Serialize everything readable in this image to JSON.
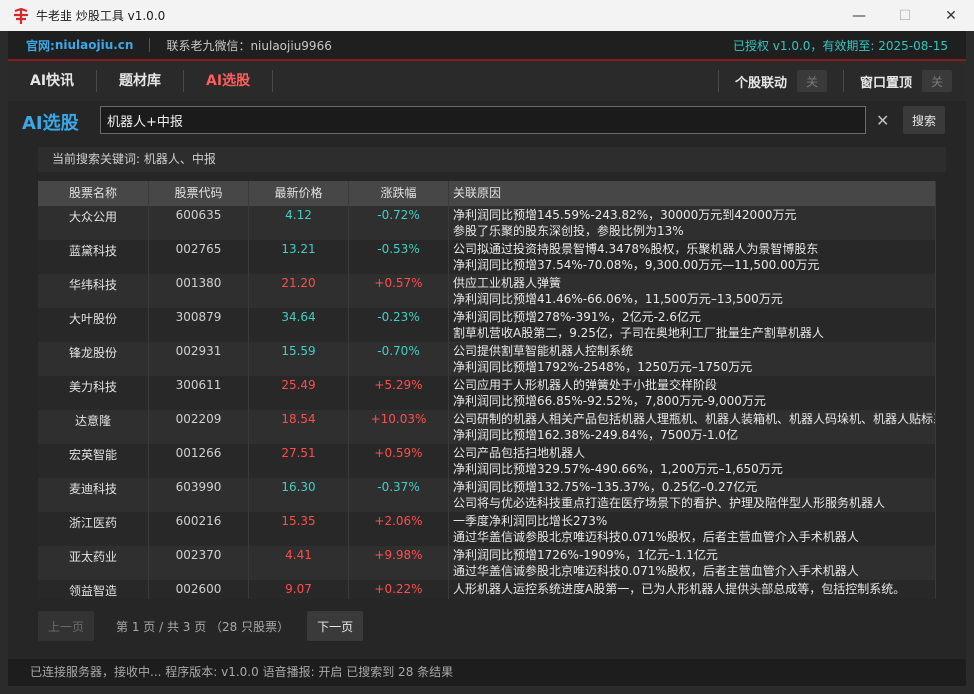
{
  "window": {
    "title": "牛老韭 炒股工具 v1.0.0",
    "controls": {
      "minimize": "—",
      "maximize": "☐",
      "close": "✕"
    }
  },
  "infobar": {
    "site_label": "官网: ",
    "site_url": "niulaojiu.cn",
    "contact": "联系老九微信：niulaojiu9966",
    "license": "已授权 v1.0.0，有效期至: 2025-08-15"
  },
  "nav": {
    "tabs": [
      {
        "label": "AI快讯"
      },
      {
        "label": "题材库"
      },
      {
        "label": "AI选股",
        "active": true
      }
    ],
    "linkage_label": "个股联动",
    "linkage_toggle": "关",
    "pin_label": "窗口置顶",
    "pin_toggle": "关"
  },
  "search": {
    "label": "AI选股",
    "value": "机器人+中报",
    "clear": "✕",
    "button": "搜索"
  },
  "keyword_bar": "当前搜索关键词: 机器人、中报",
  "table": {
    "headers": [
      "股票名称",
      "股票代码",
      "最新价格",
      "涨跌幅",
      "关联原因"
    ],
    "rows": [
      {
        "name": "大众公用",
        "code": "600635",
        "price": "4.12",
        "change": "-0.72%",
        "dir": "down",
        "reason1": "净利润同比预增145.59%-243.82%，30000万元到42000万元",
        "reason2": "参股了乐聚的股东深创投，参股比例为13%"
      },
      {
        "name": "蓝黛科技",
        "code": "002765",
        "price": "13.21",
        "change": "-0.53%",
        "dir": "down",
        "reason1": "公司拟通过投资持股景智博4.3478%股权，乐聚机器人为景智博股东",
        "reason2": "净利润同比预增37.54%-70.08%，9,300.00万元—11,500.00万元"
      },
      {
        "name": "华纬科技",
        "code": "001380",
        "price": "21.20",
        "change": "+0.57%",
        "dir": "up",
        "reason1": "供应工业机器人弹簧",
        "reason2": "净利润同比预增41.46%-66.06%，11,500万元–13,500万元"
      },
      {
        "name": "大叶股份",
        "code": "300879",
        "price": "34.64",
        "change": "-0.23%",
        "dir": "down",
        "reason1": "净利润同比预增278%-391%，2亿元-2.6亿元",
        "reason2": "割草机营收A股第二，9.25亿，子司在奥地利工厂批量生产割草机器人"
      },
      {
        "name": "锋龙股份",
        "code": "002931",
        "price": "15.59",
        "change": "-0.70%",
        "dir": "down",
        "reason1": "公司提供割草智能机器人控制系统",
        "reason2": "净利润同比预增1792%-2548%，1250万元–1750万元"
      },
      {
        "name": "美力科技",
        "code": "300611",
        "price": "25.49",
        "change": "+5.29%",
        "dir": "up",
        "reason1": "公司应用于人形机器人的弹簧处于小批量交样阶段",
        "reason2": "净利润同比预增66.85%-92.52%，7,800万元-9,000万元"
      },
      {
        "name": "达意隆",
        "code": "002209",
        "price": "18.54",
        "change": "+10.03%",
        "dir": "up",
        "reason1": "公司研制的机器人相关产品包括机器人理瓶机、机器人装箱机、机器人码垛机、机器人贴标系统",
        "reason2": "净利润同比预增162.38%-249.84%，7500万-1.0亿"
      },
      {
        "name": "宏英智能",
        "code": "001266",
        "price": "27.51",
        "change": "+0.59%",
        "dir": "up",
        "reason1": "公司产品包括扫地机器人",
        "reason2": "净利润同比预增329.57%-490.66%，1,200万元–1,650万元"
      },
      {
        "name": "麦迪科技",
        "code": "603990",
        "price": "16.30",
        "change": "-0.37%",
        "dir": "down",
        "reason1": "净利润同比预增132.75%–135.37%，0.25亿–0.27亿元",
        "reason2": "公司将与优必选科技重点打造在医疗场景下的看护、护理及陪伴型人形服务机器人"
      },
      {
        "name": "浙江医药",
        "code": "600216",
        "price": "15.35",
        "change": "+2.06%",
        "dir": "up",
        "reason1": "一季度净利润同比增长273%",
        "reason2": "通过华盖信诚参股北京唯迈科技0.071%股权，后者主营血管介入手术机器人"
      },
      {
        "name": "亚太药业",
        "code": "002370",
        "price": "4.41",
        "change": "+9.98%",
        "dir": "up",
        "reason1": "净利润同比预增1726%-1909%，1亿元–1.1亿元",
        "reason2": "通过华盖信诚参股北京唯迈科技0.071%股权，后者主营血管介入手术机器人"
      },
      {
        "name": "领益智造",
        "code": "002600",
        "price": "9.07",
        "change": "+0.22%",
        "dir": "up",
        "reason1": "人形机器人运控系统进度A股第一，已为人形机器人提供头部总成等，包括控制系统。",
        "reason2": ""
      }
    ]
  },
  "pager": {
    "prev": "上一页",
    "info": "第 1 页 / 共 3 页  （28 只股票）",
    "next": "下一页"
  },
  "status": "已连接服务器，接收中...   程序版本: v1.0.0   语音播报: 开启   已搜索到 28 条结果"
}
